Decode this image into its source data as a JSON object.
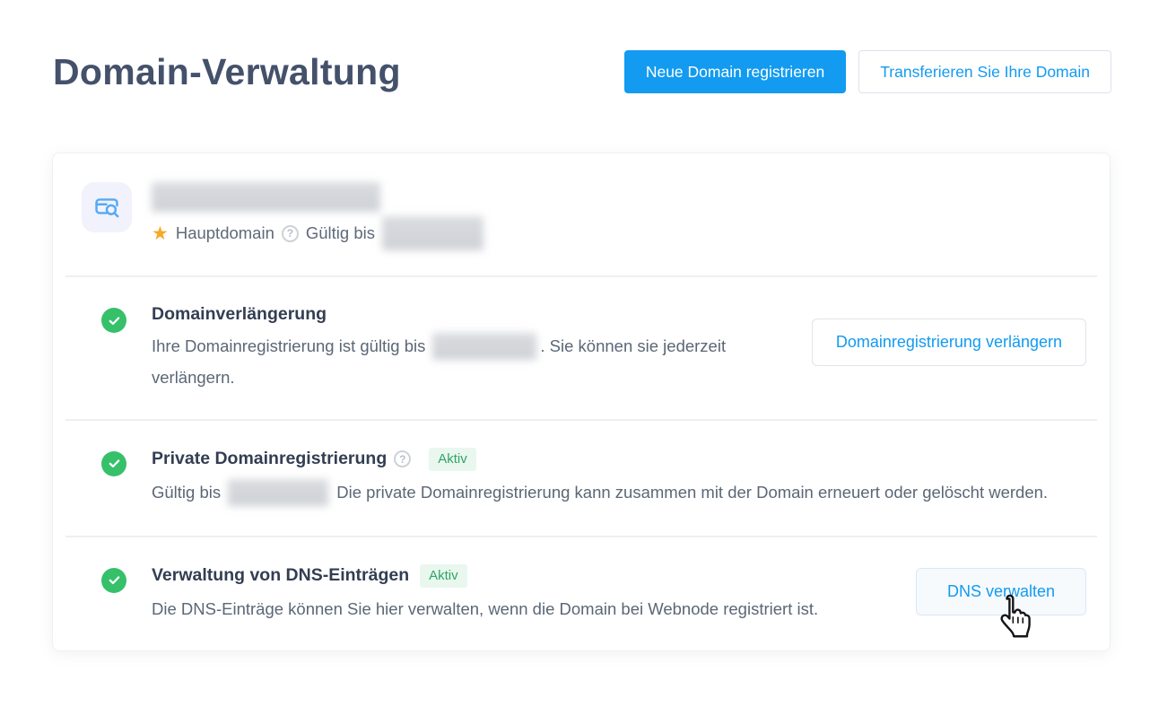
{
  "page": {
    "title": "Domain-Verwaltung"
  },
  "toolbar": {
    "register_button": "Neue Domain registrieren",
    "transfer_button": "Transferieren Sie Ihre Domain"
  },
  "domain_card": {
    "domain_name_redacted": true,
    "main_domain_label": "Hauptdomain",
    "valid_until_label": "Gültig bis",
    "valid_until_redacted": true,
    "sections": [
      {
        "title": "Domainverlängerung",
        "text_before_redaction": "Ihre Domainregistrierung ist gültig bis",
        "redacted_date": true,
        "text_after_redaction": ". Sie können sie jederzeit verlängern.",
        "button": "Domainregistrierung verlängern"
      },
      {
        "title": "Private Domainregistrierung",
        "badge": "Aktiv",
        "text_before_redaction": "Gültig bis",
        "redacted_date": true,
        "text_after_redaction": "Die private Domainregistrierung kann zusammen mit der Domain erneuert oder gelöscht werden."
      },
      {
        "title": "Verwaltung von DNS-Einträgen",
        "badge": "Aktiv",
        "text": "Die DNS-Einträge können Sie hier verwalten, wenn die Domain bei Webnode registriert ist.",
        "button": "DNS verwalten",
        "cursor_hovering": true
      }
    ]
  },
  "icons": {
    "tile": "domain-search-icon",
    "main_domain": "star-icon",
    "help": "question-mark-icon",
    "status": "check-circle-icon",
    "cursor": "hand-pointer-cursor"
  },
  "colors": {
    "accent_blue": "#129bf0",
    "title_navy": "#44516b",
    "heading_navy": "#333e52",
    "body_slate": "#5b6776",
    "success_green": "#36c06a",
    "badge_bg": "#e9f7ef",
    "badge_text": "#2fa565",
    "star_gold": "#f7a827",
    "tile_bg": "#f1f2fc"
  }
}
